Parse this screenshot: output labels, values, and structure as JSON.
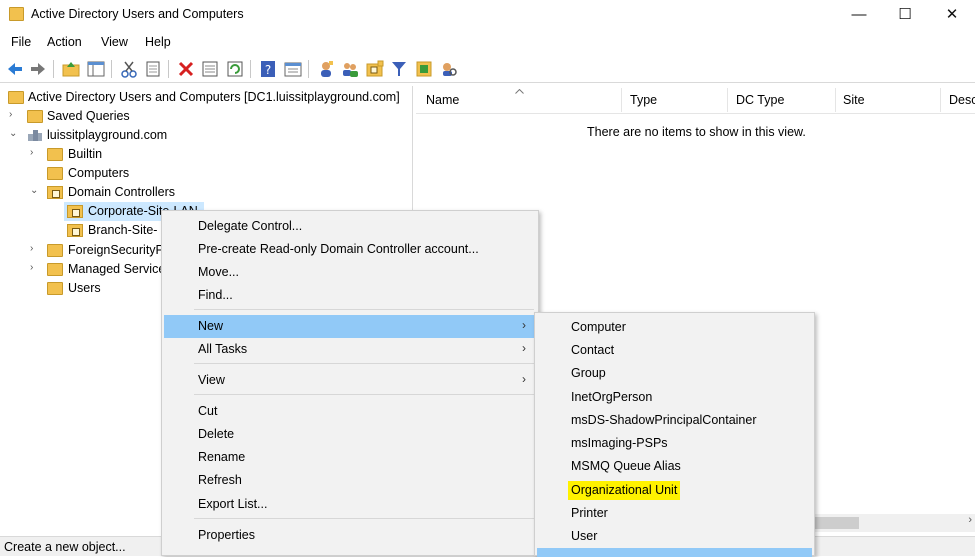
{
  "window": {
    "title": "Active Directory Users and Computers",
    "minimize": "—",
    "maximize": "☐",
    "close": "✕"
  },
  "menubar": [
    "File",
    "Action",
    "View",
    "Help"
  ],
  "toolbar_icons": [
    "back-icon",
    "forward-icon",
    "up-folder-icon",
    "show-hide-tree-icon",
    "cut-icon",
    "copy-icon",
    "delete-icon",
    "properties-icon",
    "refresh-icon",
    "help-icon",
    "console-tree-icon",
    "new-user-icon",
    "new-group-icon",
    "new-ou-icon",
    "filter-icon",
    "add-to-group-icon",
    "find-icon"
  ],
  "tree": {
    "root": "Active Directory Users and Computers [DC1.luissitplayground.com]",
    "saved_queries": "Saved Queries",
    "domain": "luissitplayground.com",
    "builtin": "Builtin",
    "computers": "Computers",
    "domain_controllers": "Domain Controllers",
    "corporate_site": "Corporate-Site-LAN",
    "branch_site": "Branch-Site-",
    "foreign_security": "ForeignSecurityP",
    "managed_service": "Managed Service",
    "users": "Users"
  },
  "list": {
    "columns": [
      "Name",
      "Type",
      "DC Type",
      "Site",
      "Desc"
    ],
    "empty_message": "There are no items to show in this view."
  },
  "status": "Create a new object...",
  "context_menu": {
    "items": [
      {
        "label": "Delegate Control...",
        "submenu": false
      },
      {
        "label": "Pre-create Read-only Domain Controller account...",
        "submenu": false
      },
      {
        "label": "Move...",
        "submenu": false
      },
      {
        "label": "Find...",
        "submenu": false
      },
      {
        "label": "New",
        "submenu": true
      },
      {
        "label": "All Tasks",
        "submenu": true
      },
      {
        "label": "View",
        "submenu": true
      },
      {
        "label": "Cut",
        "submenu": false
      },
      {
        "label": "Delete",
        "submenu": false
      },
      {
        "label": "Rename",
        "submenu": false
      },
      {
        "label": "Refresh",
        "submenu": false
      },
      {
        "label": "Export List...",
        "submenu": false
      },
      {
        "label": "Properties",
        "submenu": false
      }
    ],
    "submenu_arrow": "›"
  },
  "new_submenu": {
    "items": [
      "Computer",
      "Contact",
      "Group",
      "InetOrgPerson",
      "msDS-ShadowPrincipalContainer",
      "msImaging-PSPs",
      "MSMQ Queue Alias",
      "Organizational Unit",
      "Printer",
      "User"
    ],
    "highlighted": "Organizational Unit"
  },
  "colors": {
    "menu_highlight": "#91c9f7",
    "yellow_highlight": "#fff200",
    "selection": "#cce8ff"
  }
}
